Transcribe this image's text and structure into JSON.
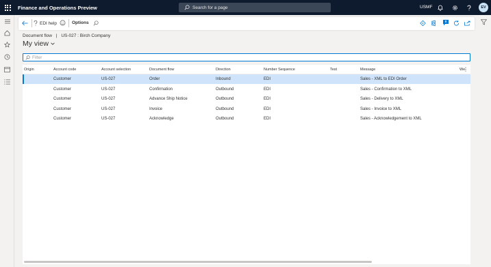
{
  "topbar": {
    "app_title": "Finance and Operations Preview",
    "search_placeholder": "Search for a page",
    "company": "USMF",
    "avatar_initials": "EV"
  },
  "actionpane": {
    "edi_help_label": "EDI help",
    "options_label": "Options",
    "notification_count": "0"
  },
  "breadcrumb": {
    "part1": "Document flow",
    "separator": "|",
    "part2": "US-027 : Birch Company"
  },
  "view": {
    "title": "My view"
  },
  "filter": {
    "placeholder": "Filter"
  },
  "grid": {
    "columns": [
      "Origin",
      "Account code",
      "Account selection",
      "Document flow",
      "Direction",
      "Number Sequence",
      "Test",
      "Message",
      "We"
    ],
    "rows": [
      {
        "origin": "",
        "account_code": "Customer",
        "account_selection": "US-027",
        "document_flow": "Order",
        "direction": "Inbound",
        "number_sequence": "EDI",
        "test": "",
        "message": "Sales - XML to EDI Order"
      },
      {
        "origin": "",
        "account_code": "Customer",
        "account_selection": "US-027",
        "document_flow": "Confirmation",
        "direction": "Outbound",
        "number_sequence": "EDI",
        "test": "",
        "message": "Sales - Confirmation to XML"
      },
      {
        "origin": "",
        "account_code": "Customer",
        "account_selection": "US-027",
        "document_flow": "Advance Ship Notice",
        "direction": "Outbound",
        "number_sequence": "EDI",
        "test": "",
        "message": "Sales - Delivery to XML"
      },
      {
        "origin": "",
        "account_code": "Customer",
        "account_selection": "US-027",
        "document_flow": "Invoice",
        "direction": "Outbound",
        "number_sequence": "EDI",
        "test": "",
        "message": "Sales - Invoice to XML"
      },
      {
        "origin": "",
        "account_code": "Customer",
        "account_selection": "US-027",
        "document_flow": "Acknowledge",
        "direction": "Outbound",
        "number_sequence": "EDI",
        "test": "",
        "message": "Sales - Acknowledgement to XML"
      }
    ],
    "selected_row": 0
  },
  "colors": {
    "topbar_bg": "#0e1a2d",
    "accent": "#0078d4",
    "selected_row_bg": "#cfe4fa"
  },
  "icons": {
    "waffle": "waffle-icon",
    "search": "search-icon",
    "bell": "bell-icon",
    "settings": "gear-icon",
    "help": "help-icon",
    "back": "back-arrow-icon",
    "filter": "filter-icon"
  }
}
